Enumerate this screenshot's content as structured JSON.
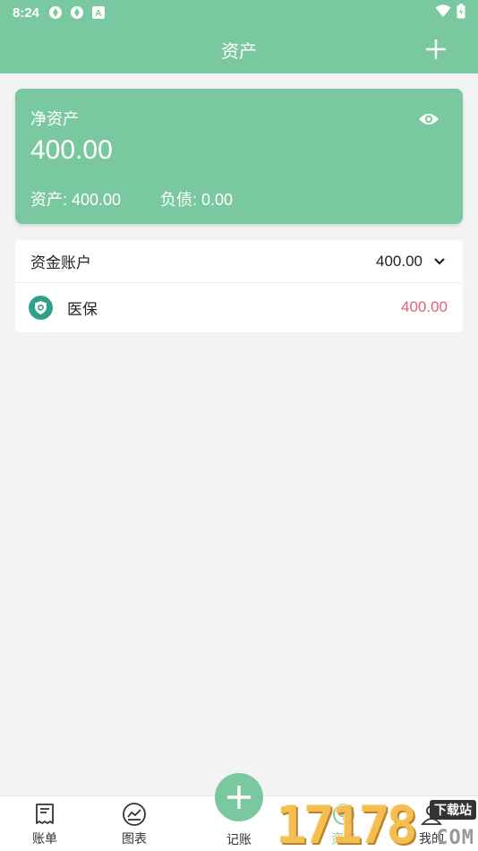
{
  "status_bar": {
    "time": "8:24",
    "indicator_letter": "A"
  },
  "app_bar": {
    "title": "资产",
    "add_icon": "plus-icon"
  },
  "net_asset_card": {
    "label": "净资产",
    "amount": "400.00",
    "assets_text": "资产: 400.00",
    "debts_text": "负债: 0.00",
    "visibility_icon": "eye-icon"
  },
  "account_group": {
    "name": "资金账户",
    "total": "400.00",
    "expand_icon": "chevron-down-icon",
    "accounts": [
      {
        "name": "医保",
        "value": "400.00",
        "icon": "medical-insurance-icon"
      }
    ]
  },
  "bottom_nav": {
    "items": [
      {
        "label": "账单",
        "icon": "bill-icon"
      },
      {
        "label": "图表",
        "icon": "chart-icon"
      },
      {
        "label": "记账",
        "icon": "plus-icon"
      },
      {
        "label": "资产",
        "icon": "asset-icon"
      },
      {
        "label": "我的",
        "icon": "profile-icon"
      }
    ]
  },
  "watermark": {
    "number": "17178",
    "tag": "下载站",
    "suffix": "COM"
  },
  "colors": {
    "primary": "#7ac8a0",
    "negative_value": "#e0607a",
    "background": "#f2f3f5",
    "account_icon_bg": "#2fa08a"
  }
}
